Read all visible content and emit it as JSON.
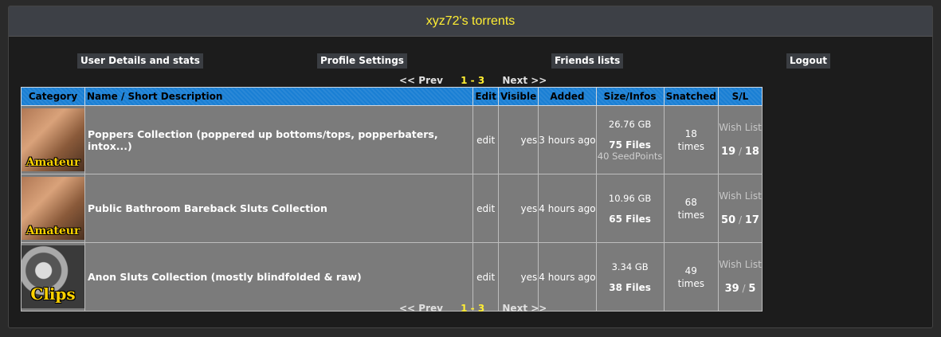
{
  "header": {
    "title": "xyz72's torrents"
  },
  "nav": {
    "user_details": "User Details and stats",
    "profile_settings": "Profile Settings",
    "friends_lists": "Friends lists",
    "logout": "Logout"
  },
  "pager": {
    "prev": "<< Prev",
    "current": "1 - 3",
    "next": "Next >>"
  },
  "table": {
    "headers": {
      "category": "Category",
      "name": "Name / Short Description",
      "edit": "Edit",
      "visible": "Visible",
      "added": "Added",
      "size": "Size/Infos",
      "snatched": "Snatched",
      "sl": "S/L"
    },
    "rows": [
      {
        "category_label": "Amateur",
        "name": "Poppers Collection (poppered up bottoms/tops, popperbaters, intox...)",
        "edit": "edit",
        "visible": "yes",
        "added": "3 hours ago",
        "size": "26.76 GB",
        "files": "75 Files",
        "seedpoints": "40 SeedPoints",
        "snatched_count": "18",
        "snatched_unit": "times",
        "wish": "Wish List",
        "seeders": "19",
        "sep": "/",
        "leechers": "18"
      },
      {
        "category_label": "Amateur",
        "name": "Public Bathroom Bareback Sluts Collection",
        "edit": "edit",
        "visible": "yes",
        "added": "4 hours ago",
        "size": "10.96 GB",
        "files": "65 Files",
        "seedpoints": "",
        "snatched_count": "68",
        "snatched_unit": "times",
        "wish": "Wish List",
        "seeders": "50",
        "sep": "/",
        "leechers": "17"
      },
      {
        "category_label": "Clips",
        "name": "Anon Sluts Collection (mostly blindfolded & raw)",
        "edit": "edit",
        "visible": "yes",
        "added": "4 hours ago",
        "size": "3.34 GB",
        "files": "38 Files",
        "seedpoints": "",
        "snatched_count": "49",
        "snatched_unit": "times",
        "wish": "Wish List",
        "seeders": "39",
        "sep": "/",
        "leechers": "5"
      }
    ]
  }
}
